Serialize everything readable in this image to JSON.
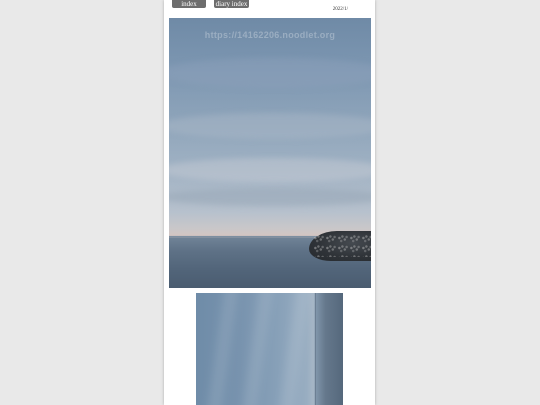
{
  "nav": {
    "index_label": "index",
    "diary_index_label": "diary index"
  },
  "header": {
    "date": "2022/1/"
  },
  "photos": [
    {
      "subject": "overcast sky over calm sea with breakwater",
      "watermark": "https://14162206.noodlet.org"
    },
    {
      "subject": "rotated overcast seascape"
    }
  ],
  "colors": {
    "background": "#e9e9e9",
    "page": "#ffffff",
    "nav_button": "#6d6d6d",
    "nav_text": "#ffffff"
  }
}
